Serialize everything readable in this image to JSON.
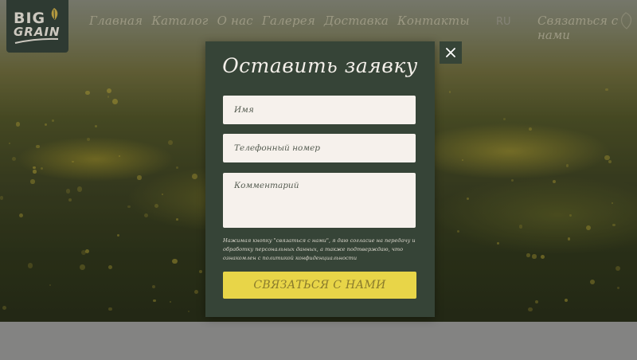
{
  "brand": {
    "line1": "BIG",
    "line2": "GRAIN"
  },
  "nav": {
    "items": [
      "Главная",
      "Каталог",
      "О нас",
      "Галерея",
      "Доставка",
      "Контакты"
    ]
  },
  "header": {
    "language": "RU",
    "contact_label": "Связаться с нами"
  },
  "modal": {
    "title": "Оставить заявку",
    "close_icon": "close-icon",
    "name_placeholder": "Имя",
    "phone_placeholder": "Телефонный номер",
    "comment_placeholder": "Комментарий",
    "consent_text": "Нажимая кнопку \"связаться с нами\", я даю согласие на передачу и обработку персональных данных, а также подтверждаю, что ознакомлен с политикой конфиденциальности",
    "submit_label": "СВЯЗАТЬСЯ С НАМИ"
  },
  "colors": {
    "modal_bg": "#364437",
    "input_bg": "#f6f1ec",
    "button_bg": "#e8d548",
    "button_text": "#8a7b2c"
  }
}
